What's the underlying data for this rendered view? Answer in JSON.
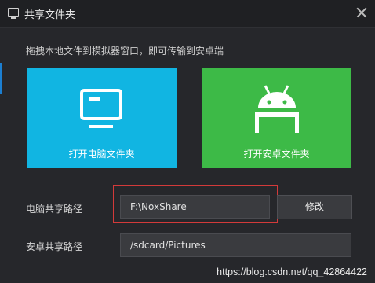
{
  "window": {
    "title": "共享文件夹"
  },
  "description": "拖拽本地文件到模拟器窗口，即可传输到安卓端",
  "tiles": {
    "pc_label": "打开电脑文件夹",
    "android_label": "打开安卓文件夹",
    "pc_color": "#11b5e2",
    "android_color": "#3dba47"
  },
  "pc_share": {
    "label": "电脑共享路径",
    "value": "F:\\NoxShare",
    "button_label": "修改"
  },
  "android_share": {
    "label": "安卓共享路径",
    "value": "/sdcard/Pictures"
  },
  "watermark": "https://blog.csdn.net/qq_42864422",
  "colors": {
    "background": "#26272b",
    "highlight": "#d33a3a"
  }
}
